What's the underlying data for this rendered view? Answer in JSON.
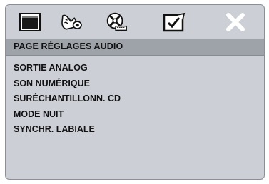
{
  "tabs": [
    {
      "name": "general-setup",
      "icon": "screen-icon"
    },
    {
      "name": "audio-setup",
      "icon": "speaker-icon",
      "active": true
    },
    {
      "name": "dolby-setup",
      "icon": "disc-icon"
    },
    {
      "name": "preferences",
      "icon": "checkbox-icon"
    },
    {
      "name": "exit",
      "icon": "close-icon"
    }
  ],
  "page": {
    "title": "PAGE RÉGLAGES AUDIO"
  },
  "menu": {
    "items": [
      {
        "label": "SORTIE ANALOG"
      },
      {
        "label": "SON NUMÉRIQUE"
      },
      {
        "label": "SURÉCHANTILLONN. CD"
      },
      {
        "label": "MODE NUIT"
      },
      {
        "label": "SYNCHR. LABIALE"
      }
    ]
  },
  "colors": {
    "panel": "#ccd0d6",
    "title_bar": "#9ea3aa",
    "text": "#111111",
    "icon": "#ffffff"
  }
}
